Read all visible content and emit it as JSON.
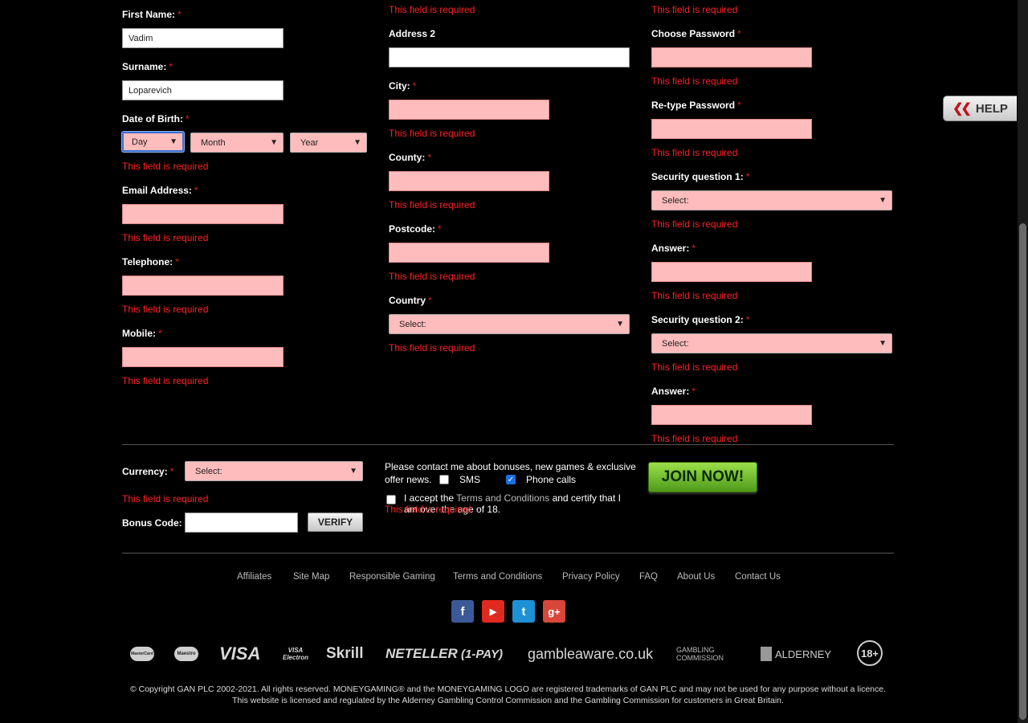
{
  "required_mark": "*",
  "error_text": "This field is required",
  "col1": {
    "first_name": {
      "label": "First Name:",
      "value": "Vadim"
    },
    "surname": {
      "label": "Surname:",
      "value": "Loparevich"
    },
    "dob": {
      "label": "Date of Birth:",
      "day": "Day",
      "month": "Month",
      "year": "Year"
    },
    "email": {
      "label": "Email Address:"
    },
    "telephone": {
      "label": "Telephone:"
    },
    "mobile": {
      "label": "Mobile:"
    }
  },
  "col2": {
    "address2": {
      "label": "Address 2"
    },
    "city": {
      "label": "City:"
    },
    "county": {
      "label": "County:"
    },
    "postcode": {
      "label": "Postcode:"
    },
    "country": {
      "label": "Country",
      "value": "Select:"
    }
  },
  "col3": {
    "choose_password": {
      "label": "Choose Password"
    },
    "retype_password": {
      "label": "Re-type Password"
    },
    "sec_q1": {
      "label": "Security question 1:",
      "value": "Select:"
    },
    "answer1": {
      "label": "Answer:"
    },
    "sec_q2": {
      "label": "Security question 2:",
      "value": "Select:"
    },
    "answer2": {
      "label": "Answer:"
    }
  },
  "bottom": {
    "currency": {
      "label": "Currency:",
      "value": "Select:"
    },
    "bonus_code": {
      "label": "Bonus Code:"
    },
    "verify_label": "VERIFY",
    "contact_text_1": "Please contact me about bonuses, new games & exclusive",
    "contact_text_2": "offer news.",
    "sms_label": "SMS",
    "sms_checked": false,
    "phone_label": "Phone calls",
    "phone_checked": true,
    "accept_pre": "I accept the",
    "accept_link": "Terms and Conditions",
    "accept_post": "and certify that I",
    "accept_line2": "am over the age of 18.",
    "join_label": "JOIN NOW!"
  },
  "help_label": "HELP",
  "footer": {
    "links": [
      "Affiliates",
      "Site Map",
      "Responsible Gaming",
      "Terms and Conditions",
      "Privacy Policy",
      "FAQ",
      "About Us",
      "Contact Us"
    ],
    "social": [
      {
        "name": "facebook",
        "glyph": "f",
        "color": "#3b5998"
      },
      {
        "name": "youtube",
        "glyph": "▶",
        "color": "#e02a20"
      },
      {
        "name": "twitter",
        "glyph": "t",
        "color": "#1e90d6"
      },
      {
        "name": "google-plus",
        "glyph": "g+",
        "color": "#d8473a"
      }
    ],
    "payments": [
      "MasterCard",
      "Maestro",
      "VISA",
      "VISA Electron",
      "Skrill",
      "NETELLER",
      "(1-PAY)",
      "gambleaware.co.uk",
      "GAMBLING COMMISSION",
      "ALDERNEY",
      "18+"
    ],
    "copyright_1": "© Copyright GAN PLC 2002-2021. All rights reserved. MONEYGAMING® and the MONEYGAMING LOGO are registered trademarks of GAN PLC and may not be used for any purpose without a licence.",
    "copyright_2": "This website is licensed and regulated by the Alderney Gambling Control Commission and the Gambling Commission for customers in Great Britain."
  }
}
